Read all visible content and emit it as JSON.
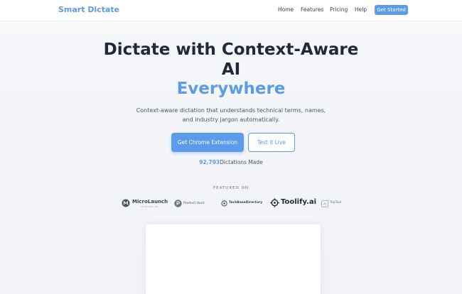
{
  "header": {
    "brand": "Smart Dictate",
    "nav": [
      "Home",
      "Features",
      "Pricing",
      "Help"
    ],
    "cta": "Get Started"
  },
  "hero": {
    "title_line1": "Dictate with Context-Aware",
    "title_line2": "AI",
    "title_highlight": "Everywhere",
    "subtitle_line1": "Context-aware dictation that understands technical terms, names,",
    "subtitle_line2": "and industry jargon automatically.",
    "primary_button": "Get Chrome Extension",
    "secondary_button": "Test it Live",
    "stats_number": "92,793",
    "stats_label": "Dictations Made"
  },
  "featured": {
    "heading": "FEATURED ON",
    "logos": [
      {
        "name": "MicroLaunch",
        "sub": "by Emmett · ML",
        "icon": "microlaunch-logo-icon"
      },
      {
        "name": "Product Hunt",
        "icon": "product-hunt-logo-icon"
      },
      {
        "name": "TechBaseDirectory",
        "icon": "techbase-logo-icon"
      },
      {
        "name": "Toolify.ai",
        "icon": "toolify-logo-icon"
      },
      {
        "name": "TopTool",
        "icon": "toptool-logo-icon"
      }
    ]
  },
  "colors": {
    "accent": "#5b9bea",
    "heading": "#1f2937",
    "body_text": "#4b5563"
  }
}
